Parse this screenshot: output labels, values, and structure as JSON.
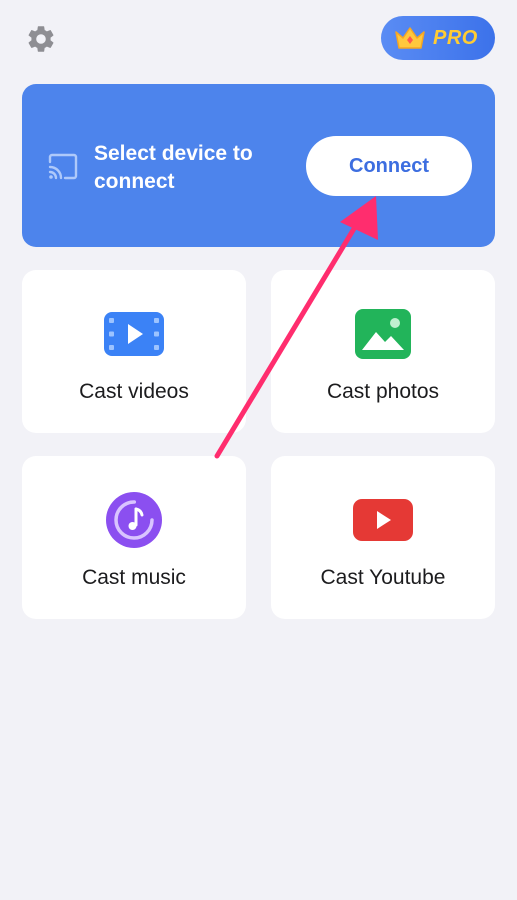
{
  "header": {
    "settings_icon": "gear-icon",
    "pro_icon": "crown-icon",
    "pro_label": "PRO"
  },
  "connect_card": {
    "icon": "cast-icon",
    "title": "Select device to connect",
    "button_label": "Connect",
    "background_color": "#4d84ec"
  },
  "tiles": [
    {
      "label": "Cast videos",
      "icon": "video-icon",
      "color": "#3b82f6"
    },
    {
      "label": "Cast photos",
      "icon": "photo-icon",
      "color": "#22b45a"
    },
    {
      "label": "Cast music",
      "icon": "music-icon",
      "color": "#8b4ff0"
    },
    {
      "label": "Cast Youtube",
      "icon": "youtube-icon",
      "color": "#e53935"
    }
  ],
  "annotation": {
    "arrow_color": "#ff2d6e"
  }
}
